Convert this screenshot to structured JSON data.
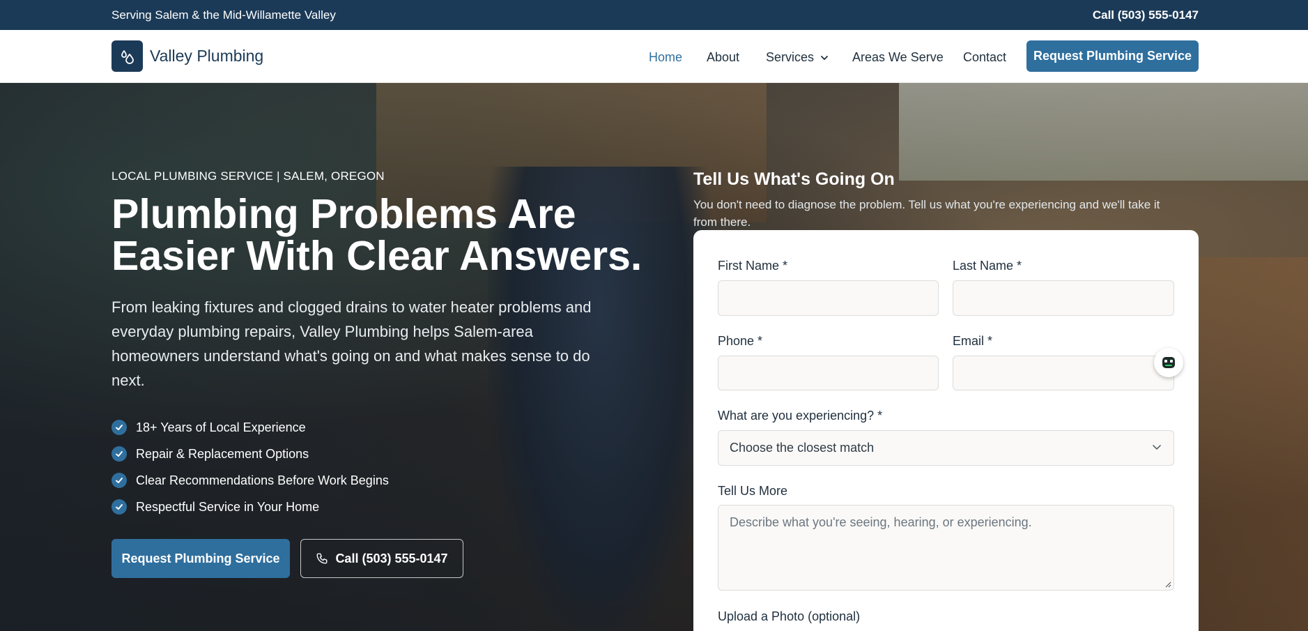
{
  "topbar": {
    "tagline": "Serving Salem & the Mid-Willamette Valley",
    "call": "Call (503) 555-0147"
  },
  "header": {
    "brand": "Valley Plumbing",
    "logo_icon": "water-drop-icon",
    "nav": {
      "home": "Home",
      "about": "About",
      "services": "Services",
      "areas": "Areas We Serve",
      "contact": "Contact"
    },
    "cta": "Request Plumbing Service"
  },
  "hero": {
    "eyebrow": "LOCAL PLUMBING SERVICE | SALEM, OREGON",
    "headline": "Plumbing Problems Are Easier With Clear Answers.",
    "subhead": "From leaking fixtures and clogged drains to water heater problems and everyday plumbing repairs, Valley Plumbing helps Salem-area homeowners understand what's going on and what makes sense to do next.",
    "checks": [
      "18+ Years of Local Experience",
      "Repair & Replacement Options",
      "Clear Recommendations Before Work Begins",
      "Respectful Service in Your Home"
    ],
    "primary_button": "Request Plumbing Service",
    "call_button": "Call (503) 555-0147"
  },
  "form": {
    "title": "Tell Us What's Going On",
    "subtitle": "You don't need to diagnose the problem. Tell us what you're experiencing and we'll take it from there.",
    "first_name_label": "First Name *",
    "last_name_label": "Last Name *",
    "phone_label": "Phone *",
    "email_label": "Email *",
    "experience_label": "What are you experiencing? *",
    "experience_selected": "Choose the closest match",
    "more_label": "Tell Us More",
    "more_placeholder": "Describe what you're seeing, hearing, or experiencing.",
    "photo_label": "Upload a Photo (optional)"
  },
  "colors": {
    "navy": "#1b3a57",
    "accent_blue": "#2f6f9e",
    "white": "#ffffff"
  }
}
